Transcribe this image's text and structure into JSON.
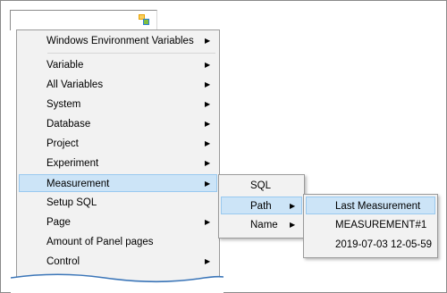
{
  "main_menu": {
    "items": [
      {
        "label": "Windows Environment Variables",
        "submenu": true
      },
      {
        "label": "Variable",
        "submenu": true
      },
      {
        "label": "All Variables",
        "submenu": true
      },
      {
        "label": "System",
        "submenu": true
      },
      {
        "label": "Database",
        "submenu": true
      },
      {
        "label": "Project",
        "submenu": true
      },
      {
        "label": "Experiment",
        "submenu": true
      },
      {
        "label": "Measurement",
        "submenu": true,
        "selected": true
      },
      {
        "label": "Setup SQL",
        "submenu": false
      },
      {
        "label": "Page",
        "submenu": true
      },
      {
        "label": "Amount of Panel pages",
        "submenu": false
      },
      {
        "label": "Control",
        "submenu": true
      }
    ]
  },
  "measurement_menu": {
    "items": [
      {
        "label": "SQL",
        "submenu": false
      },
      {
        "label": "Path",
        "submenu": true,
        "selected": true
      },
      {
        "label": "Name",
        "submenu": true
      }
    ]
  },
  "path_menu": {
    "items": [
      {
        "label": "Last Measurement",
        "selected": true
      },
      {
        "label": "MEASUREMENT#1"
      },
      {
        "label": "2019-07-03 12-05-59"
      }
    ]
  },
  "arrow_glyph": "▶",
  "colors": {
    "menu_bg": "#f2f2f2",
    "selected_bg": "#cce4f7",
    "selected_border": "#99c9ef"
  }
}
